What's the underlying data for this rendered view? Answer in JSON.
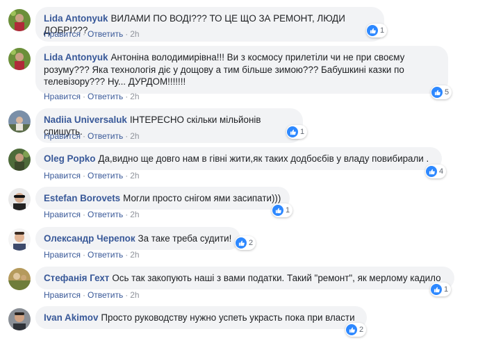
{
  "actions": {
    "like": "Нравится",
    "reply": "Ответить",
    "dot": "·"
  },
  "comments": [
    {
      "author": "Lida Antonyuk",
      "text": "ВИЛАМИ ПО ВОДІ??? ТО ЦЕ ЩО ЗА РЕМОНТ, ЛЮДИ ДОБРІ???",
      "likes": "1",
      "time": "2h"
    },
    {
      "author": "Lida Antonyuk",
      "text": "Антоніна володимирівна!!! Ви з космосу прилетіли чи не при своєму розуму??? Яка технологія діє у дощову а тим більше зимою??? Бабушкині казки по телевізору??? Ну... ДУРДОМ!!!!!!!",
      "likes": "5",
      "time": "2h"
    },
    {
      "author": "Nadiia Universaluk",
      "text": "ІНТЕРЕСНО скільки мільйонів спишуть.",
      "likes": "1",
      "time": "2h"
    },
    {
      "author": "Oleg Popko",
      "text": "Да,видно ще довго нам в гівні жити,як таких додбоєбів у владу повибирали .",
      "likes": "4",
      "time": "2h"
    },
    {
      "author": "Estefan Borovets",
      "text": "Могли просто снігом ями засипати)))",
      "likes": "1",
      "time": "2h"
    },
    {
      "author": "Олександр Черепок",
      "text": "За таке треба судити!",
      "likes": "2",
      "time": "2h"
    },
    {
      "author": "Стефанія Гехт",
      "text": "Ось так закопують наші з вами податки. Такий \"ремонт\", як мерлому кадило",
      "likes": "1",
      "time": "2h"
    },
    {
      "author": "Ivan Akimov",
      "text": "Просто руководству нужно успеть украсть пока при власти",
      "likes": "2",
      "time": "2h"
    }
  ],
  "colors": {
    "name": "#385898",
    "like_blue": "#2d88ff",
    "bubble": "#f2f3f5",
    "meta": "#90949c"
  }
}
